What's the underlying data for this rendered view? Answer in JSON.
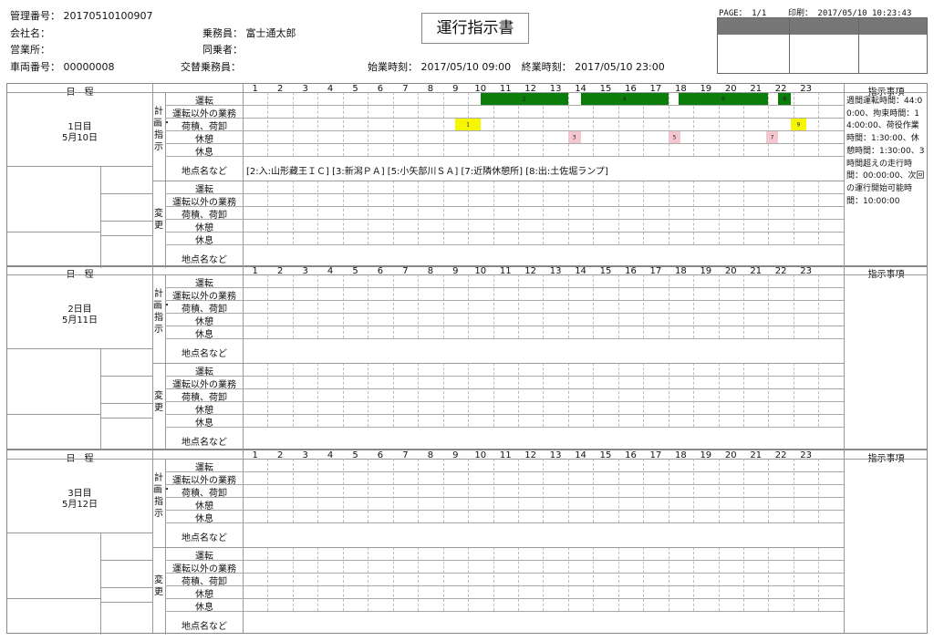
{
  "header": {
    "mgmt_label": "管理番号：",
    "mgmt_value": "20170510100907",
    "company_label": "会社名：",
    "office_label": "営業所：",
    "vehicle_label": "車両番号：",
    "vehicle_value": "00000008",
    "crew_label": "乗務員：",
    "crew_value": "富士通太郎",
    "co_label": "同乗者：",
    "relief_label": "交替乗務員：",
    "start_label": "始業時刻：",
    "start_value": "2017/05/10 09:00",
    "end_label": "終業時刻：",
    "end_value": "2017/05/10 23:00",
    "title": "運行指示書",
    "page": "PAGE： 1/1",
    "print": "印刷： 2017/05/10 10:23:43"
  },
  "table": {
    "schedule_label": "日　程",
    "instructions_label": "指示事項",
    "hours": [
      "1",
      "2",
      "3",
      "4",
      "5",
      "6",
      "7",
      "8",
      "9",
      "10",
      "11",
      "12",
      "13",
      "14",
      "15",
      "16",
      "17",
      "18",
      "19",
      "20",
      "21",
      "22",
      "23"
    ],
    "plan_label": "計画・指示",
    "change_label": "変更",
    "row_labels": [
      "運転",
      "運転以外の業務",
      "荷積、荷卸",
      "休憩",
      "休息"
    ],
    "place_label": "地点名など"
  },
  "days": [
    {
      "day": "1日目",
      "date": "5月10日",
      "places": "[2:入:山形藏王ＩＣ] [3:新潟ＰＡ] [5:小矢部川ＳＡ] [7:近隣休憩所] [8:出:土佐堀ランプ]",
      "notes": "週間運転時間：44:00:00、拘束時間：14:00:00、荷役作業時間：1:30:00、休憩時間：1:30:00、3時間超えの走行時間：00:00:00、次回の運行開始可能時間：10:00:00",
      "bars": [
        {
          "row": 0,
          "start": 10.0,
          "end": 13.5,
          "label": "2",
          "color": "#0a7d0a"
        },
        {
          "row": 0,
          "start": 14.0,
          "end": 17.5,
          "label": "4",
          "color": "#0a7d0a"
        },
        {
          "row": 0,
          "start": 17.9,
          "end": 21.5,
          "label": "6",
          "color": "#0a7d0a"
        },
        {
          "row": 0,
          "start": 21.9,
          "end": 22.4,
          "label": "8",
          "color": "#0a7d0a"
        },
        {
          "row": 2,
          "start": 9.0,
          "end": 10.0,
          "label": "1",
          "color": "#f6f600"
        },
        {
          "row": 2,
          "start": 22.4,
          "end": 23.0,
          "label": "9",
          "color": "#f6f600"
        },
        {
          "row": 3,
          "start": 13.5,
          "end": 14.0,
          "label": "3",
          "color": "#f4c6d0"
        },
        {
          "row": 3,
          "start": 17.5,
          "end": 18.0,
          "label": "5",
          "color": "#f4c6d0"
        },
        {
          "row": 3,
          "start": 21.4,
          "end": 21.9,
          "label": "7",
          "color": "#f4c6d0"
        }
      ]
    },
    {
      "day": "2日目",
      "date": "5月11日",
      "places": "",
      "notes": "",
      "bars": []
    },
    {
      "day": "3日目",
      "date": "5月12日",
      "places": "",
      "notes": "",
      "bars": []
    }
  ]
}
